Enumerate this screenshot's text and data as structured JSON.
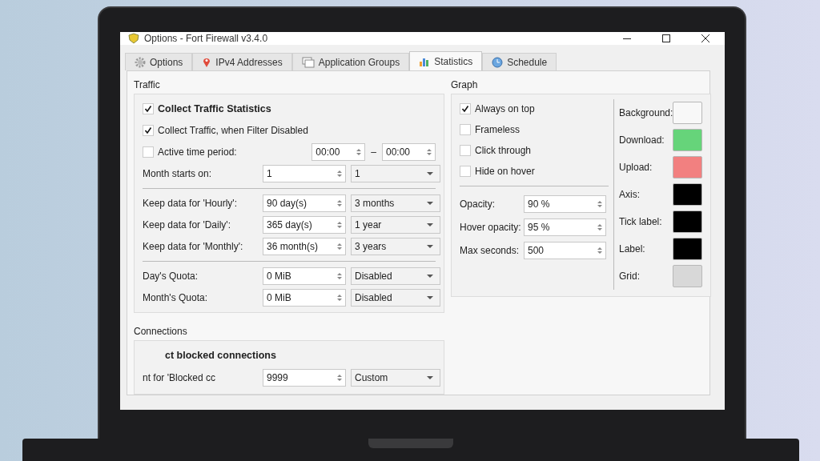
{
  "window": {
    "title": "Options - Fort Firewall v3.4.0"
  },
  "tabs": [
    {
      "label": "Options",
      "selected": false
    },
    {
      "label": "IPv4 Addresses",
      "selected": false
    },
    {
      "label": "Application Groups",
      "selected": false
    },
    {
      "label": "Statistics",
      "selected": true
    },
    {
      "label": "Schedule",
      "selected": false
    }
  ],
  "traffic": {
    "title": "Traffic",
    "sections": [
      [
        {
          "kind": "check",
          "label": "Collect Traffic Statistics",
          "checked": true,
          "bold": true
        },
        {
          "kind": "check",
          "label": "Collect Traffic, when Filter Disabled",
          "checked": true,
          "bold": false
        },
        {
          "kind": "period",
          "label": "Active time period:",
          "checked": false,
          "from": "00:00",
          "to": "00:00",
          "separator": "–"
        },
        {
          "kind": "spin",
          "label": "Month starts on:",
          "value": "1",
          "option": "1"
        }
      ],
      [
        {
          "kind": "spin",
          "label": "Keep data for 'Hourly':",
          "value": "90 day(s)",
          "option": "3 months"
        },
        {
          "kind": "spin",
          "label": "Keep data for 'Daily':",
          "value": "365 day(s)",
          "option": "1 year"
        },
        {
          "kind": "spin",
          "label": "Keep data for 'Monthly':",
          "value": "36 month(s)",
          "option": "3 years"
        }
      ],
      [
        {
          "kind": "spin",
          "label": "Day's Quota:",
          "value": "0 MiB",
          "option": "Disabled"
        },
        {
          "kind": "spin",
          "label": "Month's Quota:",
          "value": "0 MiB",
          "option": "Disabled"
        }
      ]
    ]
  },
  "connections": {
    "title": "Connections",
    "rows": [
      {
        "kind": "heading",
        "label": "ct blocked connections"
      },
      {
        "kind": "spin",
        "label": "nt for 'Blocked cc",
        "value": "9999",
        "option": "Custom"
      }
    ]
  },
  "graph": {
    "title": "Graph",
    "checks": [
      {
        "label": "Always on top",
        "checked": true
      },
      {
        "label": "Frameless",
        "checked": false
      },
      {
        "label": "Click through",
        "checked": false
      },
      {
        "label": "Hide on hover",
        "checked": false
      }
    ],
    "spins": [
      {
        "label": "Opacity:",
        "value": "90 %"
      },
      {
        "label": "Hover opacity:",
        "value": "95 %"
      },
      {
        "label": "Max seconds:",
        "value": "500"
      }
    ],
    "colors": [
      {
        "label": "Background:",
        "color": "#f8f8f8"
      },
      {
        "label": "Download:",
        "color": "#66d47a"
      },
      {
        "label": "Upload:",
        "color": "#f28080"
      },
      {
        "label": "Axis:",
        "color": "#000000"
      },
      {
        "label": "Tick label:",
        "color": "#000000"
      },
      {
        "label": "Label:",
        "color": "#000000"
      },
      {
        "label": "Grid:",
        "color": "#d8d8d8"
      }
    ]
  }
}
